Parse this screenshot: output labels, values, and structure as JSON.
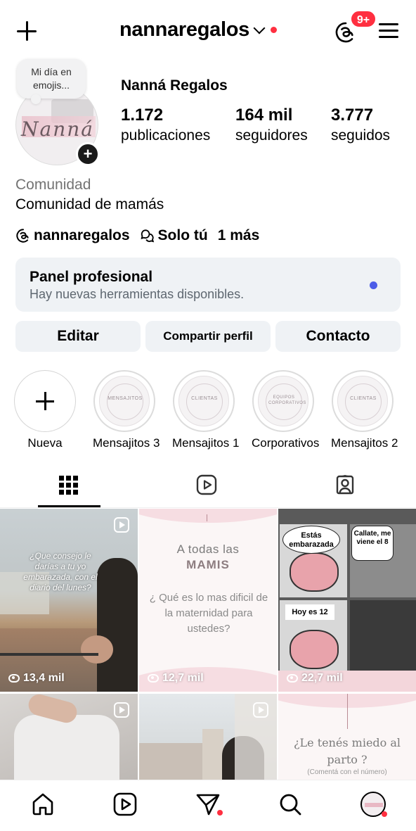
{
  "header": {
    "username": "nannaregalos",
    "notifications_badge": "9+"
  },
  "profile": {
    "note": "Mi día en emojis...",
    "display_name": "Nanná Regalos",
    "avatar_text": "Nanná",
    "stats": [
      {
        "value": "1.172",
        "label": "publicaciones"
      },
      {
        "value": "164 mil",
        "label": "seguidores"
      },
      {
        "value": "3.777",
        "label": "seguidos"
      }
    ],
    "category": "Comunidad",
    "bio": "Comunidad de mamás",
    "threads_handle": "nannaregalos",
    "audience": "Solo tú",
    "more": "1 más"
  },
  "panel": {
    "title": "Panel profesional",
    "subtitle": "Hay nuevas herramientas disponibles."
  },
  "buttons": {
    "edit": "Editar",
    "share": "Compartir perfil",
    "contact": "Contacto"
  },
  "highlights": [
    {
      "label": "Nueva",
      "cover": ""
    },
    {
      "label": "Mensajitos 3",
      "cover": "MENSAJITOS"
    },
    {
      "label": "Mensajitos 1",
      "cover": "CLIENTAS"
    },
    {
      "label": "Corporativos",
      "cover": "EQUIPOS CORPORATIVOS"
    },
    {
      "label": "Mensajitos 2",
      "cover": "CLIENTAS"
    }
  ],
  "posts": [
    {
      "text": "¿Que consejo le darías a tu yo embarazada, con el diario del lunes?",
      "views": "13,4 mil",
      "reel": true
    },
    {
      "text1": "A todas las",
      "text2": "MAMIS",
      "text3": "¿ Qué es lo mas dificil de la maternidad para ustedes?",
      "views": "12,7 mil",
      "reel": false
    },
    {
      "bubble1": "Estás embarazada",
      "bubble2": "Callate, me viene el 8",
      "bubble3": "Hoy es 12",
      "views": "22,7 mil",
      "reel": false
    },
    {
      "views": "",
      "reel": true
    },
    {
      "views": "",
      "reel": true
    },
    {
      "text1": "¿Le tenés miedo al parto ?",
      "text2": "(Comentá con el número)",
      "views": "",
      "reel": false
    }
  ],
  "colors": {
    "accent_red": "#ff2f40",
    "panel_bg": "#eff2f5",
    "panel_dot": "#4c5de8",
    "secondary_text": "#737373"
  }
}
